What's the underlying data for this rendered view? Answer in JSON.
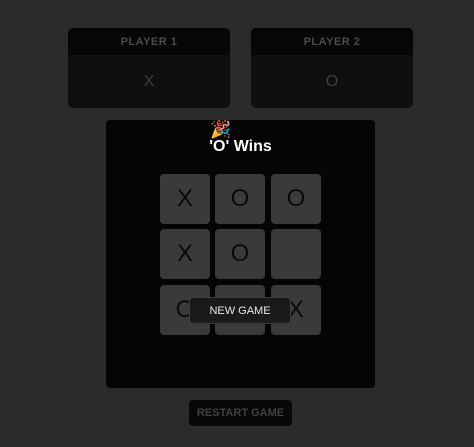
{
  "players": [
    {
      "label": "PLAYER 1",
      "symbol": "X"
    },
    {
      "label": "PLAYER 2",
      "symbol": "O"
    }
  ],
  "result": {
    "icon": "party-popper-icon",
    "icon_glyph": "🎉",
    "text": "'O' Wins"
  },
  "board": {
    "cells": [
      "X",
      "O",
      "O",
      "X",
      "O",
      "",
      "O",
      "",
      "X"
    ]
  },
  "new_game_label": "NEW GAME",
  "restart_label": "RESTART GAME",
  "colors": {
    "background": "#2b2b2b",
    "panel": "#050505",
    "cell": "#3a3a3a",
    "winner_text": "#ffffff"
  }
}
